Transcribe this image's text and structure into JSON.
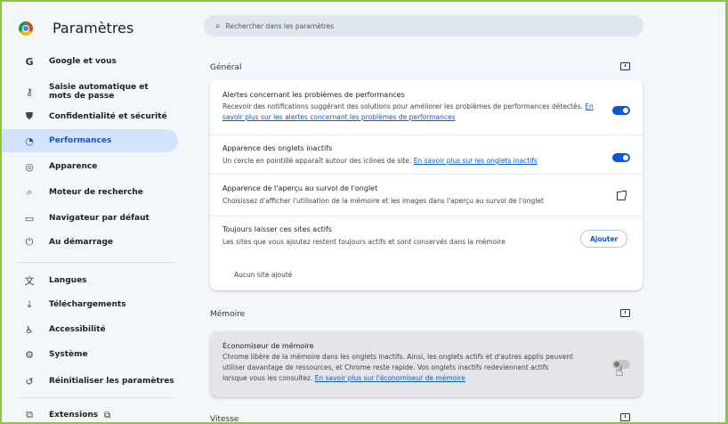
{
  "app": {
    "title": "Paramètres"
  },
  "colors": {
    "accent": "#0b57d0",
    "active_bg": "#d3e3fd",
    "frame": "#8cc63f"
  },
  "sidebar": {
    "items": [
      {
        "label": "Google et vous",
        "icon": "google-icon",
        "glyph": "G"
      },
      {
        "label": "Saisie automatique et mots de passe",
        "icon": "key-icon",
        "glyph": "⚷"
      },
      {
        "label": "Confidentialité et sécurité",
        "icon": "shield-icon",
        "glyph": "⛊"
      },
      {
        "label": "Performances",
        "icon": "speedometer-icon",
        "glyph": "◔",
        "active": true
      },
      {
        "label": "Apparence",
        "icon": "palette-icon",
        "glyph": "◎"
      },
      {
        "label": "Moteur de recherche",
        "icon": "search-icon",
        "glyph": "⌕"
      },
      {
        "label": "Navigateur par défaut",
        "icon": "browser-icon",
        "glyph": "▭"
      },
      {
        "label": "Au démarrage",
        "icon": "power-icon",
        "glyph": "⏻"
      },
      {
        "label": "Langues",
        "icon": "translate-icon",
        "glyph": "文"
      },
      {
        "label": "Téléchargements",
        "icon": "download-icon",
        "glyph": "⤓"
      },
      {
        "label": "Accessibilité",
        "icon": "accessibility-icon",
        "glyph": "♿"
      },
      {
        "label": "Système",
        "icon": "wrench-icon",
        "glyph": "⚙"
      },
      {
        "label": "Réinitialiser les paramètres",
        "icon": "reset-icon",
        "glyph": "↺"
      },
      {
        "label": "Extensions",
        "icon": "puzzle-icon",
        "glyph": "⧉"
      }
    ]
  },
  "search": {
    "placeholder": "Rechercher dans les paramètres"
  },
  "general": {
    "title": "Général",
    "alerts": {
      "title": "Alertes concernant les problèmes de performances",
      "desc": "Recevoir des notifications suggérant des solutions pour améliorer les problèmes de performances détectés.",
      "link": "En savoir plus sur les alertes concernant les problèmes de performances",
      "enabled": true
    },
    "inactive_tabs": {
      "title": "Apparence des onglets inactifs",
      "desc": "Un cercle en pointillé apparaît autour des icônes de site.",
      "link": "En savoir plus sur les onglets inactifs",
      "enabled": true
    },
    "hover_preview": {
      "title": "Apparence de l'aperçu au survol de l'onglet",
      "desc": "Choisissez d'afficher l'utilisation de la mémoire et les images dans l'aperçu au survol de l'onglet"
    },
    "always_active": {
      "title": "Toujours laisser ces sites actifs",
      "desc": "Les sites que vous ajoutez restent toujours actifs et sont conservés dans la mémoire",
      "button": "Ajouter",
      "empty": "Aucun site ajouté"
    }
  },
  "memory": {
    "title": "Mémoire",
    "saver": {
      "title": "Économiseur de mémoire",
      "desc1": "Chrome libère de la mémoire dans les onglets inactifs. Ainsi, les onglets actifs et d'autres applis peuvent",
      "desc2": "utiliser davantage de ressources, et Chrome reste rapide. Vos onglets inactifs redeviennent actifs",
      "desc3": "lorsque vous les consultez.",
      "link": "En savoir plus sur l'économiseur de mémoire",
      "enabled": false
    }
  },
  "speed": {
    "title": "Vitesse"
  }
}
